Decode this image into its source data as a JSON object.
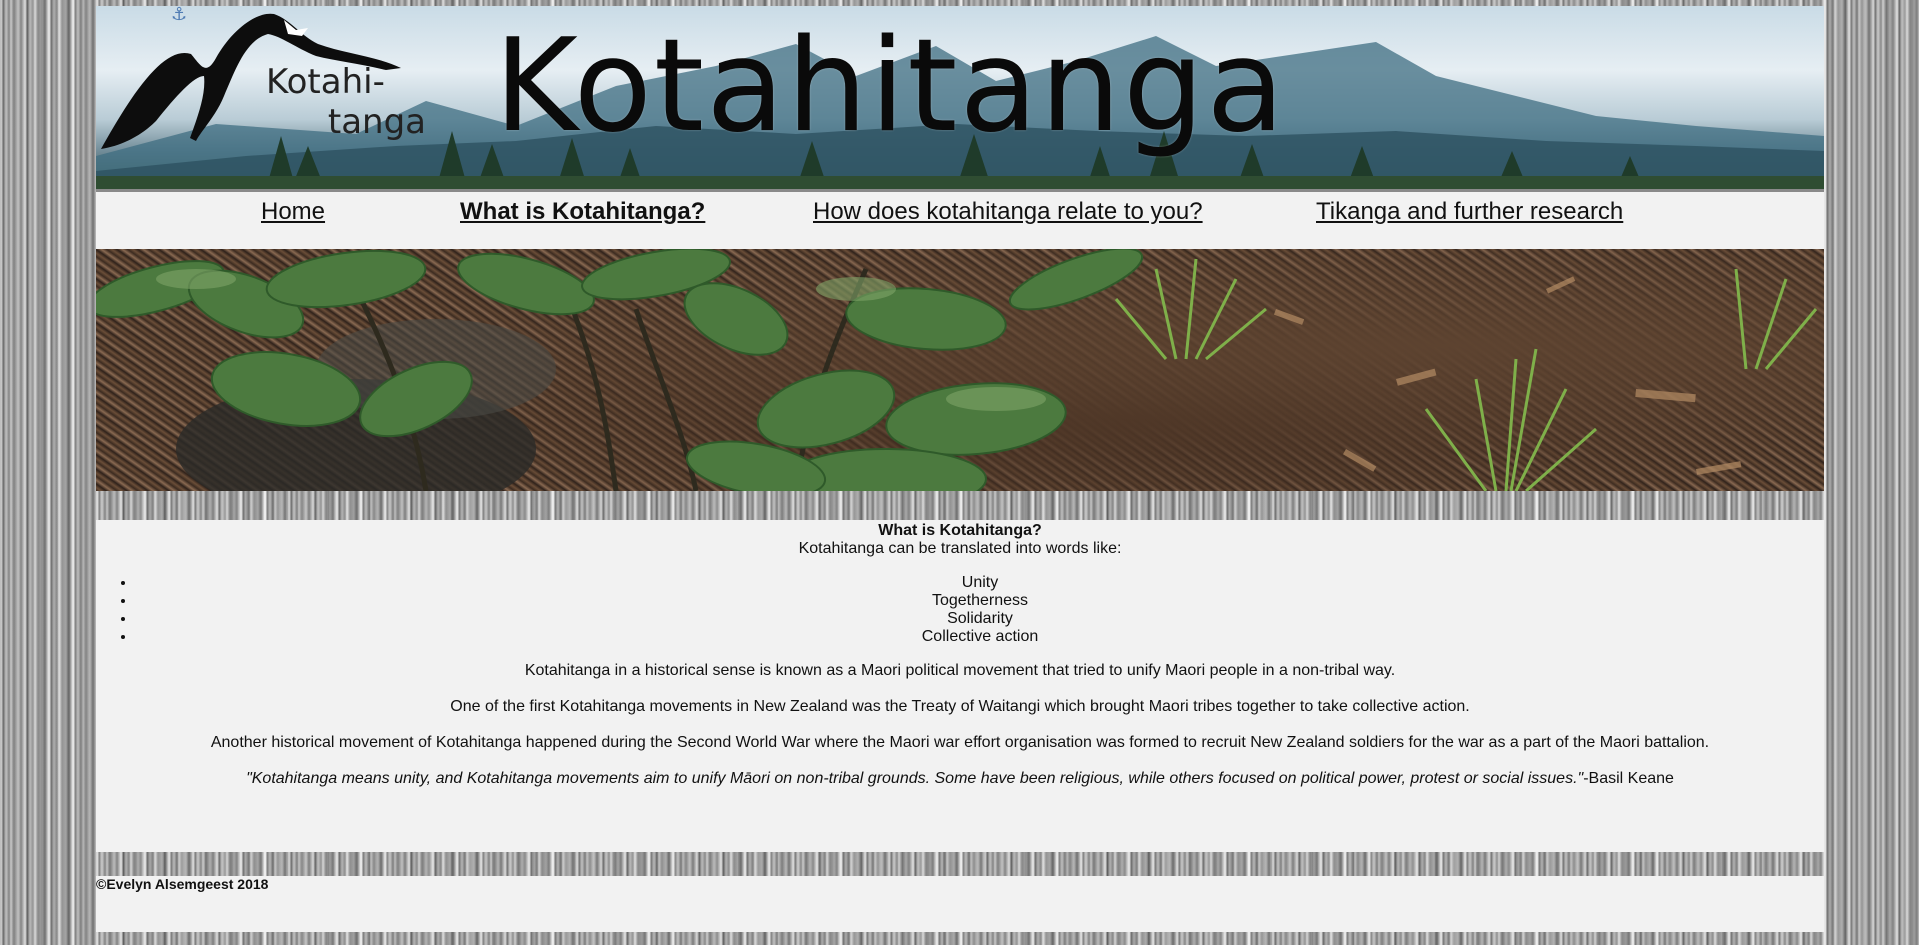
{
  "banner": {
    "logo_line1": "Kotahi-",
    "logo_line2": "tanga",
    "title": "Kotahitanga"
  },
  "nav": {
    "items": [
      {
        "label": "Home",
        "active": false
      },
      {
        "label": "What is Kotahitanga?",
        "active": true
      },
      {
        "label": "How does kotahitanga relate to you?",
        "active": false
      },
      {
        "label": "Tikanga and further research",
        "active": false
      }
    ]
  },
  "content": {
    "heading": "What is Kotahitanga?",
    "intro": "Kotahitanga can be translated into words like:",
    "list": [
      "Unity",
      "Togetherness",
      "Solidarity",
      "Collective action"
    ],
    "paragraphs": [
      "Kotahitanga in a historical sense is known as a Maori political movement that tried to unify Maori people in a non-tribal way.",
      "One of the first Kotahitanga movements in New Zealand was the Treaty of Waitangi which brought Maori tribes together to take collective action.",
      "Another historical movement of Kotahitanga happened during the Second World War where the Maori war effort organisation was formed to recruit New Zealand soldiers for the war as a part of the Maori battalion."
    ],
    "quote": "\"Kotahitanga means unity, and Kotahitanga movements aim to unify Māori on non-tribal grounds. Some have been religious, while others focused on political power, protest or social issues.\"",
    "quote_attribution": "-Basil Keane"
  },
  "footer": {
    "copyright": "©Evelyn Alsemgeest 2018"
  },
  "colors": {
    "panel_bg": "#f2f2f2",
    "anchor_icon": "#4f7bb3"
  }
}
